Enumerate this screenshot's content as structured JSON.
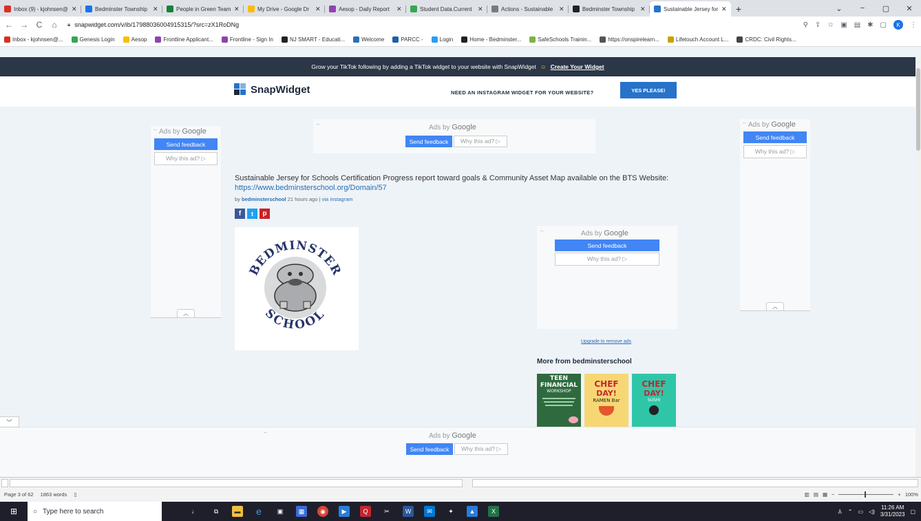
{
  "browser": {
    "tabs": [
      {
        "title": "Inbox (9) - kjohnsen@",
        "icon": "gmail-icon",
        "color": "#d93025"
      },
      {
        "title": "Bedminster Township",
        "icon": "calendar-icon",
        "color": "#1a73e8"
      },
      {
        "title": "People in Green Team",
        "icon": "sheets-icon",
        "color": "#188038"
      },
      {
        "title": "My Drive - Google Dr",
        "icon": "drive-icon",
        "color": "#fbbc04"
      },
      {
        "title": "Aesop - Daily Report",
        "icon": "frontline-icon",
        "color": "#8e44ad"
      },
      {
        "title": "Student Data.Current",
        "icon": "genesis-icon",
        "color": "#34a853"
      },
      {
        "title": "Actions - Sustainable",
        "icon": "sj-icon",
        "color": "#7a7a7a"
      },
      {
        "title": "Bedminster Township",
        "icon": "bb-icon",
        "color": "#222222"
      },
      {
        "title": "Sustainable Jersey for",
        "icon": "snapwidget-icon",
        "color": "#2673c9"
      }
    ],
    "url": "snapwidget.com/v/ib/17988036004915315/?src=zX1RoDNg",
    "avatar_letter": "K",
    "bookmarks": [
      {
        "label": "Inbox - kjohnsen@...",
        "color": "#d93025"
      },
      {
        "label": "Genesis Login",
        "color": "#34a853"
      },
      {
        "label": "Aesop",
        "color": "#fbbc04"
      },
      {
        "label": "Frontline Applicant...",
        "color": "#8e44ad"
      },
      {
        "label": "Frontline - Sign In",
        "color": "#8e44ad"
      },
      {
        "label": "NJ SMART - Educati...",
        "color": "#222222"
      },
      {
        "label": "Welcome",
        "color": "#2a6fb8"
      },
      {
        "label": "PARCC -",
        "color": "#1e5fa8"
      },
      {
        "label": "Login",
        "color": "#2a9df4"
      },
      {
        "label": "Home - Bedminster...",
        "color": "#222222"
      },
      {
        "label": "SafeSchools Trainin...",
        "color": "#7cb342"
      },
      {
        "label": "https://onspirelearn...",
        "color": "#555555"
      },
      {
        "label": "Lifetouch Account L...",
        "color": "#c8a200"
      },
      {
        "label": "CRDC: Civil Rights...",
        "color": "#444444"
      }
    ]
  },
  "page": {
    "promo_text": "Grow your TikTok following by adding a TikTok widget to your website with SnapWidget",
    "promo_link": "Create Your Widget",
    "logo": "SnapWidget",
    "need_widget": "NEED AN INSTAGRAM WIDGET FOR YOUR WEBSITE?",
    "yes_button": "YES PLEASE!",
    "ads_by": "Ads by",
    "google": "Google",
    "send_feedback": "Send feedback",
    "why_ad": "Why this ad? ▷",
    "post": {
      "caption": "Sustainable Jersey for Schools Certification Progress report toward goals & Community Asset Map available on the BTS Website:",
      "link": "https://www.bedminsterschool.org/Domain/57",
      "by": "by",
      "author": "bedminsterschool",
      "time": "21 hours ago | ",
      "via": "via Instagram",
      "image_top": "BEDMINSTER",
      "image_bottom": "SCHOOL"
    },
    "upgrade_link": "Upgrade to remove ads",
    "more_title": "More from bedminsterschool",
    "thumbs": [
      {
        "line1": "TEEN",
        "line2": "FINANCIAL",
        "line3": "WORKSHOP"
      },
      {
        "line1": "CHEF",
        "line2": "DAY!",
        "line3": "RAMEN Bar"
      },
      {
        "line1": "CHEF",
        "line2": "DAY!",
        "line3": "SUSHI"
      }
    ]
  },
  "word": {
    "page_info": "Page 3 of 62",
    "words": "1863 words",
    "zoom": "100%"
  },
  "taskbar": {
    "search_placeholder": "Type here to search",
    "time": "11:26 AM",
    "date": "3/31/2023"
  }
}
